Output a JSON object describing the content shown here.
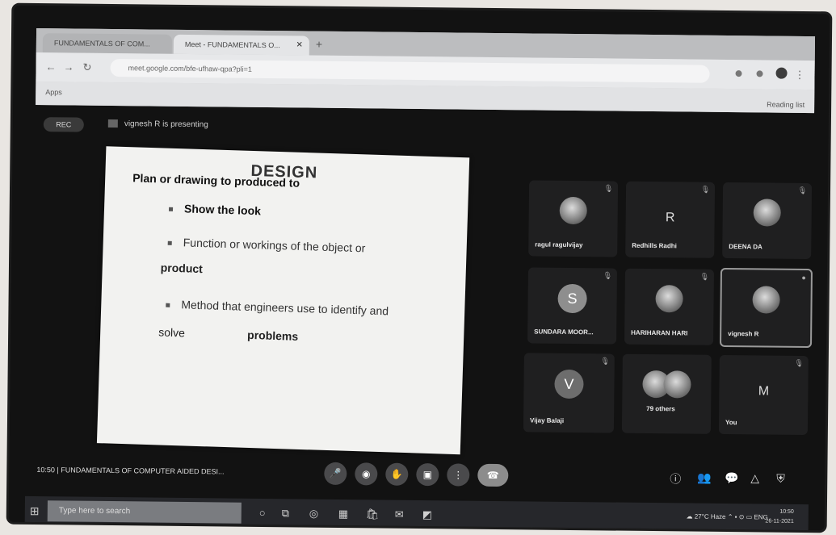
{
  "browser": {
    "tabs": [
      {
        "label": "FUNDAMENTALS OF COM...",
        "state": "inactive"
      },
      {
        "label": "Meet - FUNDAMENTALS O...",
        "state": "active"
      }
    ],
    "new_tab": "+",
    "url": "meet.google.com/bfe-ufhaw-qpa?pli=1",
    "bookmarks_apps": "Apps",
    "reading_list": "Reading list"
  },
  "meet": {
    "rec_label": "REC",
    "presenting_text": "vignesh R is presenting",
    "meeting_time": "10:50",
    "meeting_title": "FUNDAMENTALS OF COMPUTER AIDED DESI..."
  },
  "slide": {
    "title": "DESIGN",
    "lines": [
      "Plan or drawing to produced to",
      "Show the look",
      "Function or workings of the object or",
      "product",
      "Method that engineers use to identify and",
      "solve",
      "problems"
    ]
  },
  "participants": [
    {
      "name": "ragul ragulvijay",
      "kind": "photo"
    },
    {
      "name": "Redhills Radhi",
      "kind": "letter",
      "initial": "R"
    },
    {
      "name": "DEENA DA",
      "kind": "photo"
    },
    {
      "name": "SUNDARA MOOR...",
      "kind": "avatar",
      "initial": "S",
      "color": "#8e8e8e"
    },
    {
      "name": "HARIHARAN HARI",
      "kind": "photo"
    },
    {
      "name": "vignesh R",
      "kind": "photo"
    },
    {
      "name": "Vijay Balaji",
      "kind": "avatar",
      "initial": "V",
      "color": "#6d6d6d"
    },
    {
      "name": "79 others",
      "kind": "group"
    },
    {
      "name": "You",
      "kind": "letter",
      "initial": "M"
    }
  ],
  "taskbar": {
    "search_placeholder": "Type here to search",
    "weather": "27°C Haze",
    "time": "10:50",
    "date": "26-11-2021"
  }
}
